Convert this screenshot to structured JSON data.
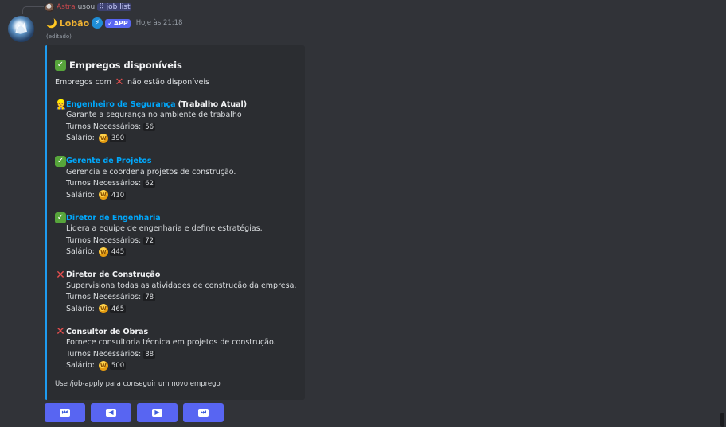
{
  "reply": {
    "author": "Astra",
    "verb": "usou",
    "command": "job list"
  },
  "message": {
    "author": "Lobão",
    "app_tag": "APP",
    "timestamp": "Hoje às 21:18",
    "edited": "(editado)"
  },
  "embed": {
    "accent_color": "#1e9cf0",
    "title": "Empregos disponíveis",
    "desc_before": "Empregos com",
    "desc_after": "não estão disponíveis",
    "jobs": [
      {
        "icon": "worker-icon",
        "status": "current",
        "name": "Engenheiro de Segurança",
        "current_label": "(Trabalho Atual)",
        "description": "Garante a segurança no ambiente de trabalho",
        "turns_label": "Turnos Necessários:",
        "turns": "56",
        "salary_label": "Salário:",
        "salary": "390"
      },
      {
        "icon": "check-icon",
        "status": "available",
        "name": "Gerente de Projetos",
        "description": "Gerencia e coordena projetos de construção.",
        "turns_label": "Turnos Necessários:",
        "turns": "62",
        "salary_label": "Salário:",
        "salary": "410"
      },
      {
        "icon": "check-icon",
        "status": "available",
        "name": "Diretor de Engenharia",
        "description": "Lidera a equipe de engenharia e define estratégias.",
        "turns_label": "Turnos Necessários:",
        "turns": "72",
        "salary_label": "Salário:",
        "salary": "445"
      },
      {
        "icon": "cross-icon",
        "status": "unavailable",
        "name": "Diretor de Construção",
        "description": "Supervisiona todas as atividades de construção da empresa.",
        "turns_label": "Turnos Necessários:",
        "turns": "78",
        "salary_label": "Salário:",
        "salary": "465"
      },
      {
        "icon": "cross-icon",
        "status": "unavailable",
        "name": "Consultor de Obras",
        "description": "Fornece consultoria técnica em projetos de construção.",
        "turns_label": "Turnos Necessários:",
        "turns": "88",
        "salary_label": "Salário:",
        "salary": "500"
      }
    ],
    "footer": "Use /job-apply para conseguir um novo emprego"
  },
  "buttons": [
    {
      "name": "first-page-button",
      "glyph": "⏮",
      "icon": "first-page-icon"
    },
    {
      "name": "previous-page-button",
      "glyph": "◀",
      "icon": "previous-page-icon"
    },
    {
      "name": "next-page-button",
      "glyph": "▶",
      "icon": "next-page-icon"
    },
    {
      "name": "last-page-button",
      "glyph": "⏭",
      "icon": "last-page-icon"
    }
  ],
  "colors": {
    "link": "#00a8fc",
    "button": "#5865f2",
    "username": "#f0b232",
    "reply_author": "#c4474c"
  }
}
